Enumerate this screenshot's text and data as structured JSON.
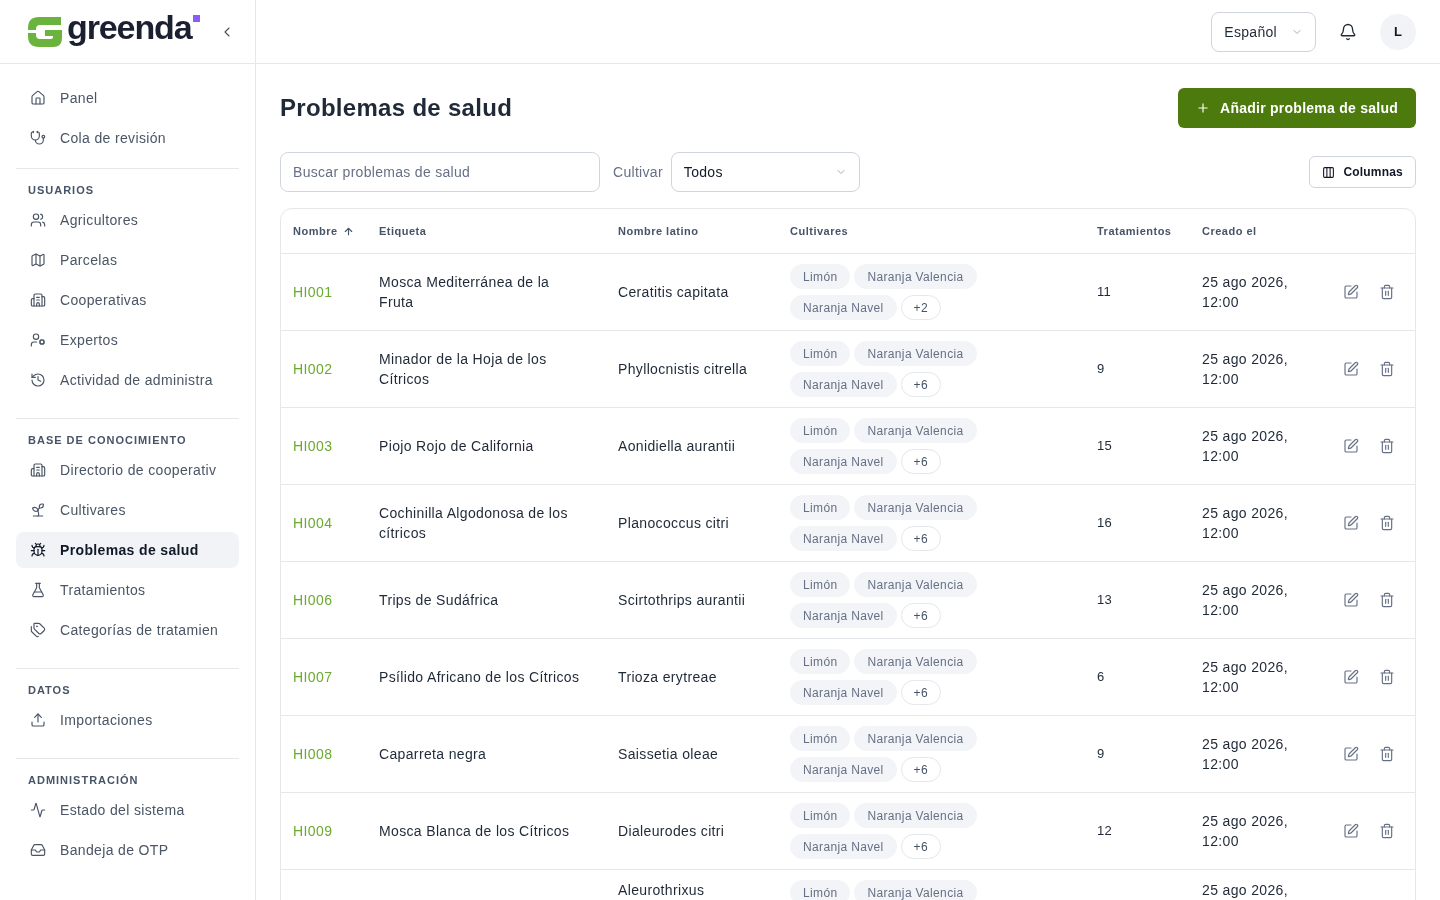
{
  "header": {
    "logo": "greenda",
    "language_select": {
      "value": "Español"
    },
    "avatar": "L"
  },
  "sidebar": {
    "sections": [
      {
        "items": [
          {
            "label": "Panel",
            "selected": false
          },
          {
            "label": "Cola de revisión",
            "selected": false
          }
        ]
      },
      {
        "title": "USUARIOS",
        "items": [
          {
            "label": "Agricultores",
            "selected": false
          },
          {
            "label": "Parcelas",
            "selected": false
          },
          {
            "label": "Cooperativas",
            "selected": false
          },
          {
            "label": "Expertos",
            "selected": false
          },
          {
            "label": "Actividad de administra",
            "selected": false
          }
        ]
      },
      {
        "title": "BASE DE CONOCIMIENTO",
        "items": [
          {
            "label": "Directorio de cooperativ",
            "selected": false
          },
          {
            "label": "Cultivares",
            "selected": false
          },
          {
            "label": "Problemas de salud",
            "selected": true
          },
          {
            "label": "Tratamientos",
            "selected": false
          },
          {
            "label": "Categorías de tratamien",
            "selected": false
          }
        ]
      },
      {
        "title": "DATOS",
        "items": [
          {
            "label": "Importaciones",
            "selected": false
          }
        ]
      },
      {
        "title": "ADMINISTRACIÓN",
        "items": [
          {
            "label": "Estado del sistema",
            "selected": false
          },
          {
            "label": "Bandeja de OTP",
            "selected": false
          }
        ]
      }
    ]
  },
  "page": {
    "title": "Problemas de salud",
    "add_button": "Añadir problema de salud"
  },
  "filters": {
    "search": {
      "placeholder": "Buscar problemas de salud"
    },
    "crop_filter": {
      "label": "Cultivar",
      "value": "Todos"
    },
    "columns_button": "Columnas"
  },
  "table": {
    "columns": [
      {
        "label": "Nombre",
        "sorted": true
      },
      {
        "label": "Etiqueta",
        "sorted": false
      },
      {
        "label": "Nombre latino",
        "sorted": false
      },
      {
        "label": "Cultivares",
        "sorted": false
      },
      {
        "label": "Tratamientos",
        "sorted": false
      },
      {
        "label": "Creado el",
        "sorted": false
      }
    ],
    "rows": [
      {
        "id": "HI001",
        "label": "Mosca Mediterránea de la Fruta",
        "latin_name": "Ceratitis capitata",
        "cultivars": [
          "Limón",
          "Naranja Valencia",
          "Naranja Navel"
        ],
        "more": "+2",
        "treatments": "11",
        "created": "25 ago 2026, 12:00"
      },
      {
        "id": "HI002",
        "label": "Minador de la Hoja de los Cítricos",
        "latin_name": "Phyllocnistis citrella",
        "cultivars": [
          "Limón",
          "Naranja Valencia",
          "Naranja Navel"
        ],
        "more": "+6",
        "treatments": "9",
        "created": "25 ago 2026, 12:00"
      },
      {
        "id": "HI003",
        "label": "Piojo Rojo de California",
        "latin_name": "Aonidiella aurantii",
        "cultivars": [
          "Limón",
          "Naranja Valencia",
          "Naranja Navel"
        ],
        "more": "+6",
        "treatments": "15",
        "created": "25 ago 2026, 12:00"
      },
      {
        "id": "HI004",
        "label": "Cochinilla Algodonosa de los cítricos",
        "latin_name": "Planococcus citri",
        "cultivars": [
          "Limón",
          "Naranja Valencia",
          "Naranja Navel"
        ],
        "more": "+6",
        "treatments": "16",
        "created": "25 ago 2026, 12:00"
      },
      {
        "id": "HI006",
        "label": "Trips de Sudáfrica",
        "latin_name": "Scirtothrips aurantii",
        "cultivars": [
          "Limón",
          "Naranja Valencia",
          "Naranja Navel"
        ],
        "more": "+6",
        "treatments": "13",
        "created": "25 ago 2026, 12:00"
      },
      {
        "id": "HI007",
        "label": "Psílido Africano de los Cítricos",
        "latin_name": "Trioza erytreae",
        "cultivars": [
          "Limón",
          "Naranja Valencia",
          "Naranja Navel"
        ],
        "more": "+6",
        "treatments": "6",
        "created": "25 ago 2026, 12:00"
      },
      {
        "id": "HI008",
        "label": "Caparreta negra",
        "latin_name": "Saissetia oleae",
        "cultivars": [
          "Limón",
          "Naranja Valencia",
          "Naranja Navel"
        ],
        "more": "+6",
        "treatments": "9",
        "created": "25 ago 2026, 12:00"
      },
      {
        "id": "HI009",
        "label": "Mosca Blanca de los Cítricos",
        "latin_name": "Dialeurodes citri",
        "cultivars": [
          "Limón",
          "Naranja Valencia",
          "Naranja Navel"
        ],
        "more": "+6",
        "treatments": "12",
        "created": "25 ago 2026, 12:00"
      },
      {
        "latin_name": "Aleurothrixus",
        "cultivars": [
          "Limón",
          "Naranja Valencia"
        ],
        "created": "25 ago 2026,"
      }
    ]
  }
}
